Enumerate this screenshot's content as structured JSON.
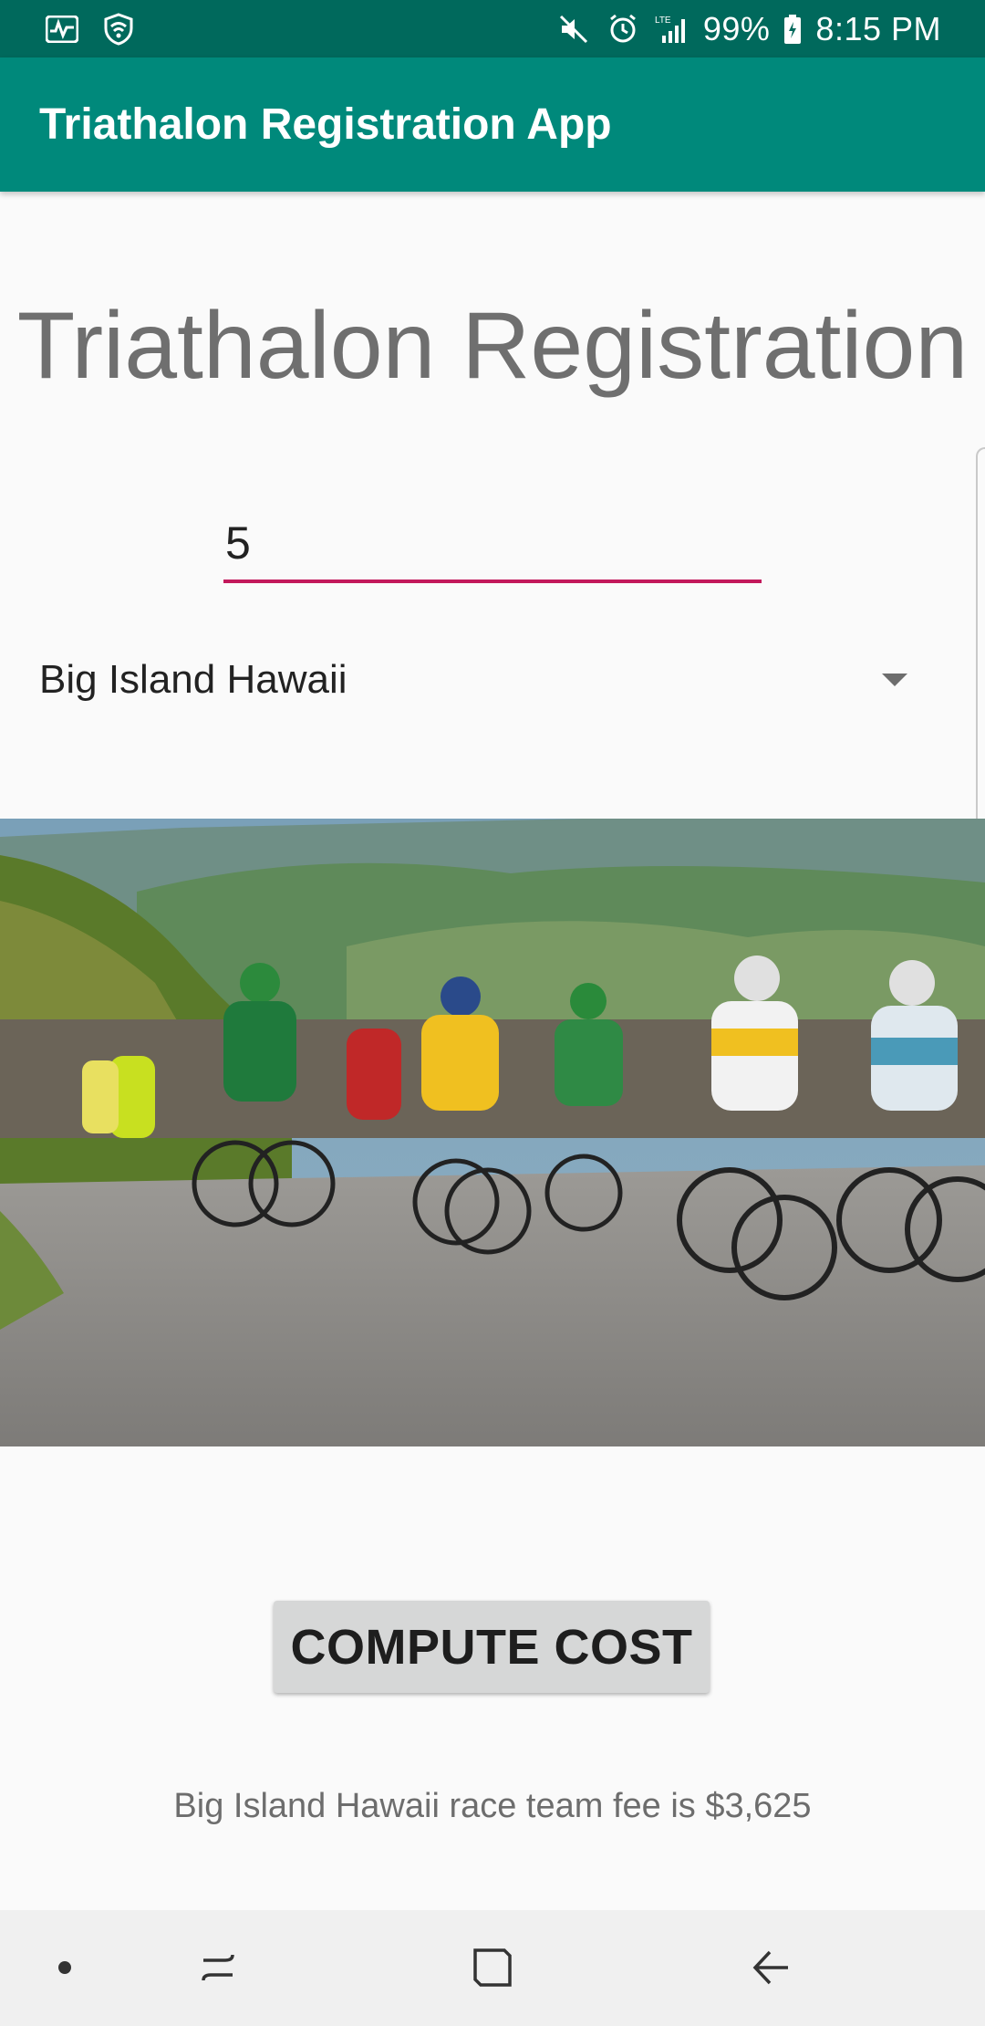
{
  "status_bar": {
    "battery": "99%",
    "time": "8:15 PM",
    "icons_left": [
      "activity-icon",
      "shield-wifi-icon"
    ],
    "icons_right": [
      "mute-icon",
      "alarm-icon",
      "lte-signal-icon",
      "battery-icon"
    ]
  },
  "app_bar": {
    "title": "Triathalon Registration App"
  },
  "main": {
    "heading": "Triathalon Registration",
    "team_input_value": "5",
    "race_location": "Big Island Hawaii",
    "compute_label": "COMPUTE COST",
    "result": "Big Island Hawaii race team fee is $3,625"
  },
  "nav_bar": {
    "icons": [
      "recents-dot-icon",
      "recent-apps-icon",
      "home-icon",
      "back-icon"
    ]
  },
  "colors": {
    "status_bar": "#00695c",
    "app_bar": "#00897b",
    "input_underline": "#c2185b",
    "button": "#d6d7d7"
  }
}
